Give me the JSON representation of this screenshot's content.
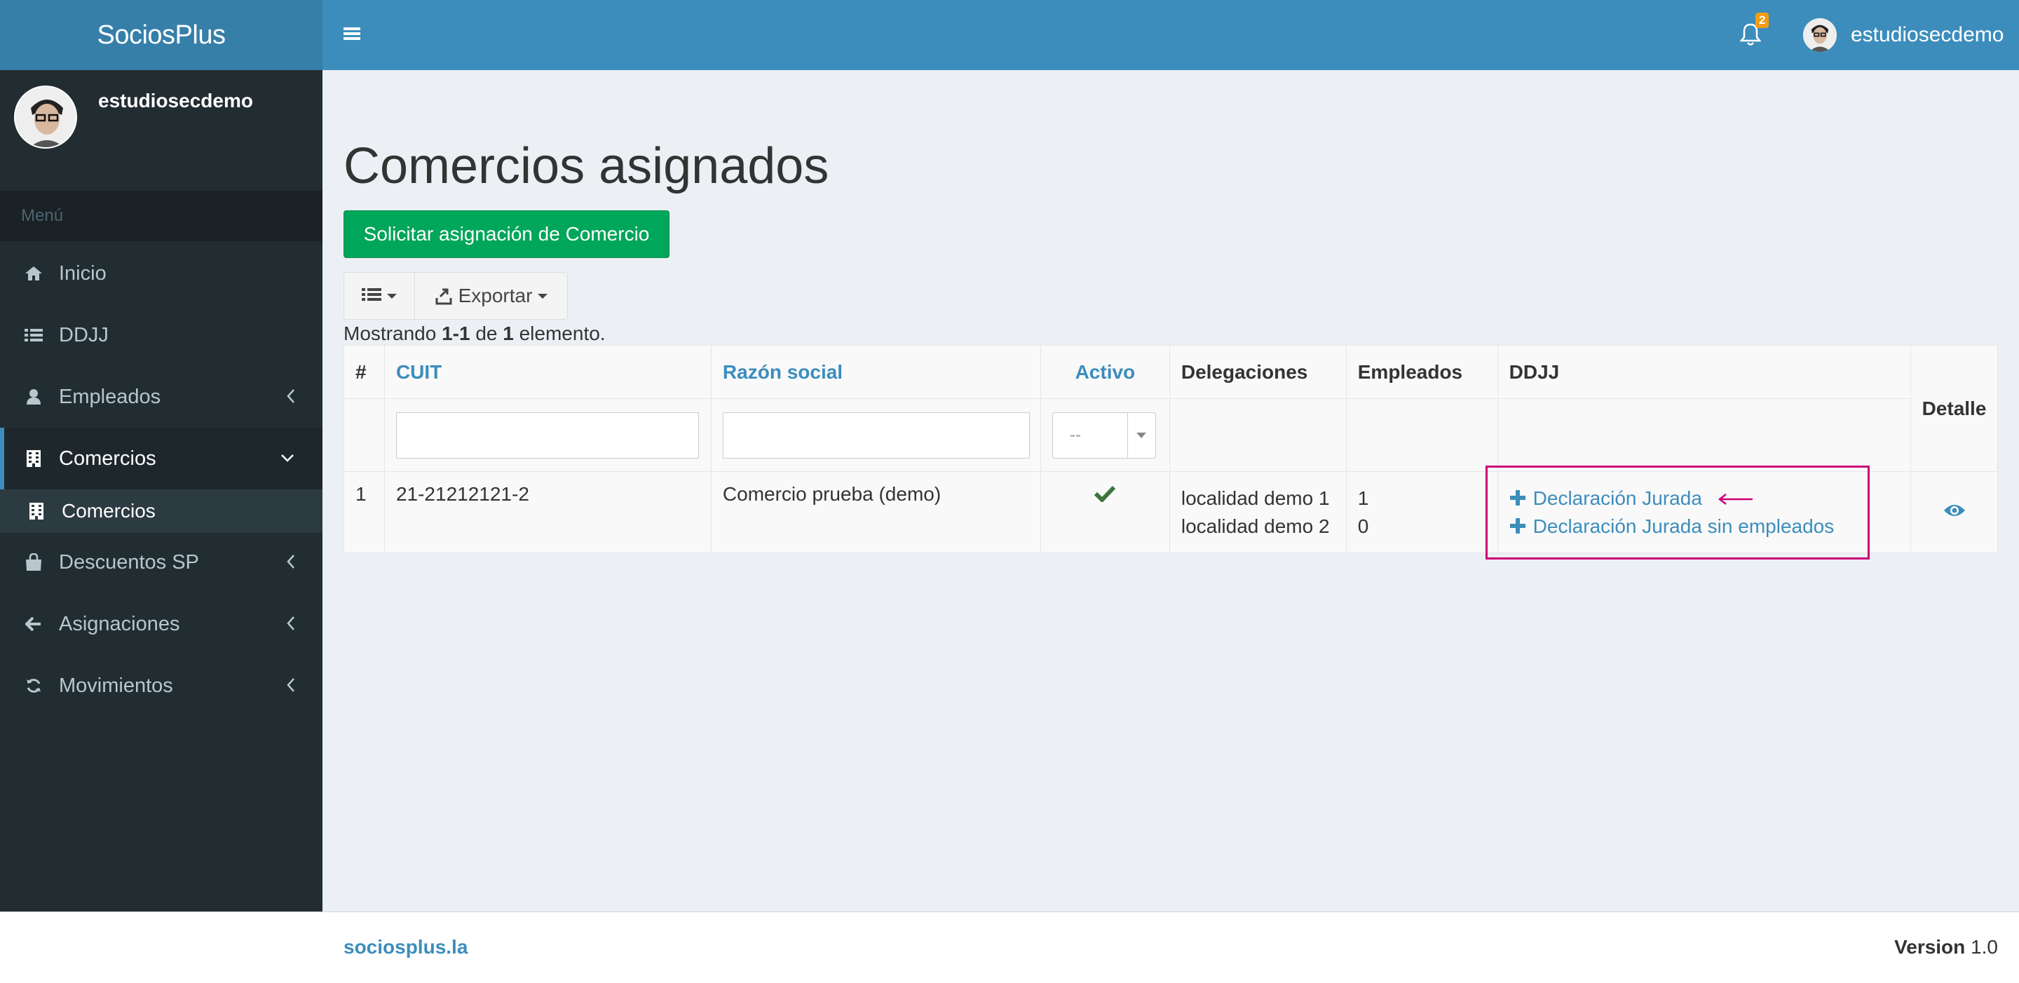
{
  "app": {
    "title": "SociosPlus"
  },
  "user": {
    "name": "estudiosecdemo"
  },
  "header": {
    "notification_count": "2",
    "user_name": "estudiosecdemo"
  },
  "sidebar": {
    "menu_header": "Menú",
    "items": [
      {
        "label": "Inicio",
        "icon": "home-icon"
      },
      {
        "label": "DDJJ",
        "icon": "list-icon"
      },
      {
        "label": "Empleados",
        "icon": "user-icon"
      },
      {
        "label": "Comercios",
        "icon": "building-icon",
        "active": true
      },
      {
        "label": "Descuentos SP",
        "icon": "shopping-bag-icon"
      },
      {
        "label": "Asignaciones",
        "icon": "arrow-left-icon"
      },
      {
        "label": "Movimientos",
        "icon": "refresh-icon"
      }
    ],
    "submenu": [
      {
        "label": "Comercios",
        "icon": "building-icon"
      }
    ]
  },
  "main": {
    "title": "Comercios asignados",
    "request_button": "Solicitar asignación de Comercio",
    "export_label": "Exportar",
    "summary": {
      "prefix": "Mostrando ",
      "range": "1-1",
      "middle": " de ",
      "total": "1",
      "suffix": " elemento."
    }
  },
  "table": {
    "columns": {
      "num": "#",
      "cuit": "CUIT",
      "razon": "Razón social",
      "activo": "Activo",
      "delegaciones": "Delegaciones",
      "empleados": "Empleados",
      "ddjj": "DDJJ",
      "detalle": "Detalle"
    },
    "filters": {
      "activo_placeholder": "--"
    },
    "rows": [
      {
        "num": "1",
        "cuit": "21-21212121-2",
        "razon": "Comercio prueba (demo)",
        "activo": "check",
        "delegaciones": [
          "localidad demo 1",
          "localidad demo 2"
        ],
        "empleados": [
          "1",
          "0"
        ],
        "ddjj_links": [
          "Declaración Jurada",
          "Declaración Jurada sin empleados"
        ]
      }
    ]
  },
  "footer": {
    "link": "sociosplus.la",
    "version_label": "Version",
    "version": "1.0"
  },
  "colors": {
    "primary": "#3c8dbc",
    "success": "#00a65a",
    "sidebar": "#222d32",
    "annotation": "#cc0077"
  }
}
